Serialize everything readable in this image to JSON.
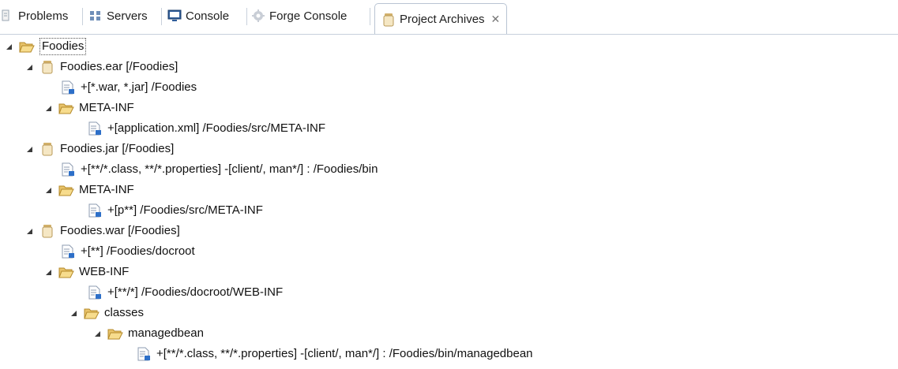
{
  "tabs": [
    {
      "label": "Problems",
      "icon": "problems-icon"
    },
    {
      "label": "Servers",
      "icon": "servers-icon"
    },
    {
      "label": "Console",
      "icon": "console-icon"
    },
    {
      "label": "Forge Console",
      "icon": "forge-console-icon"
    },
    {
      "label": "Project Archives",
      "icon": "archive-icon",
      "active": true,
      "close": "✕"
    }
  ],
  "tree": {
    "root": {
      "label": "Foodies",
      "icon": "folder-open-icon"
    },
    "ear": {
      "label": "Foodies.ear [/Foodies]",
      "icon": "jar-icon"
    },
    "ear_fileset": {
      "label": "+[*.war, *.jar] /Foodies",
      "icon": "fileset-icon"
    },
    "ear_metainf": {
      "label": "META-INF",
      "icon": "folder-open-icon"
    },
    "ear_metainf_fileset": {
      "label": "+[application.xml] /Foodies/src/META-INF",
      "icon": "fileset-icon"
    },
    "jar": {
      "label": "Foodies.jar [/Foodies]",
      "icon": "jar-icon"
    },
    "jar_fileset": {
      "label": "+[**/*.class, **/*.properties] -[client/, man*/] : /Foodies/bin",
      "icon": "fileset-icon"
    },
    "jar_metainf": {
      "label": "META-INF",
      "icon": "folder-open-icon"
    },
    "jar_metainf_fileset": {
      "label": "+[p**] /Foodies/src/META-INF",
      "icon": "fileset-icon"
    },
    "war": {
      "label": "Foodies.war [/Foodies]",
      "icon": "jar-icon"
    },
    "war_fileset": {
      "label": "+[**] /Foodies/docroot",
      "icon": "fileset-icon"
    },
    "war_webinf": {
      "label": "WEB-INF",
      "icon": "folder-open-icon"
    },
    "war_webinf_fileset": {
      "label": "+[**/*] /Foodies/docroot/WEB-INF",
      "icon": "fileset-icon"
    },
    "war_classes": {
      "label": "classes",
      "icon": "folder-open-icon"
    },
    "war_managedbean": {
      "label": "managedbean",
      "icon": "folder-open-icon"
    },
    "war_managedbean_fileset": {
      "label": "+[**/*.class, **/*.properties] -[client/, man*/] : /Foodies/bin/managedbean",
      "icon": "fileset-icon"
    }
  }
}
